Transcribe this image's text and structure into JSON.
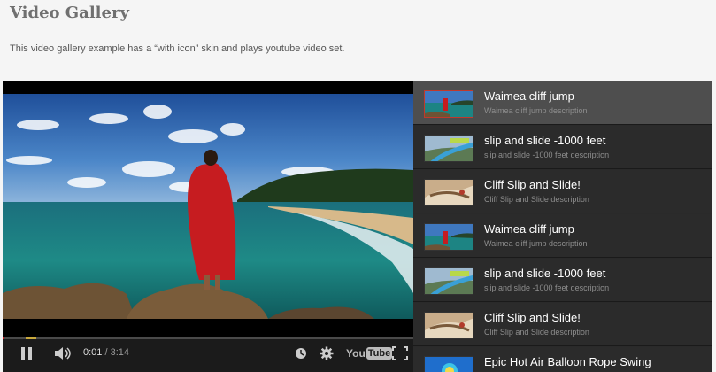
{
  "page": {
    "title": "Video Gallery",
    "description": "This video gallery example has a “with icon” skin and plays youtube video set."
  },
  "player": {
    "current_time": "0:01",
    "separator": " / ",
    "duration": "3:14",
    "progress_fraction": 0.005,
    "logo_you": "You",
    "logo_tube": "Tube"
  },
  "playlist": {
    "items": [
      {
        "title": "Waimea cliff jump",
        "description": "Waimea cliff jump description",
        "thumb": "coast",
        "active": true
      },
      {
        "title": "slip and slide -1000 feet",
        "description": "slip and slide -1000 feet description",
        "thumb": "slide",
        "active": false
      },
      {
        "title": "Cliff Slip and Slide!",
        "description": "Cliff Slip and Slide description",
        "thumb": "cliff",
        "active": false
      },
      {
        "title": "Waimea cliff jump",
        "description": "Waimea cliff jump description",
        "thumb": "coast",
        "active": false
      },
      {
        "title": "slip and slide -1000 feet",
        "description": "slip and slide -1000 feet description",
        "thumb": "slide",
        "active": false
      },
      {
        "title": "Cliff Slip and Slide!",
        "description": "Cliff Slip and Slide description",
        "thumb": "cliff",
        "active": false
      },
      {
        "title": "Epic Hot Air Balloon Rope Swing",
        "description": "",
        "thumb": "balloon",
        "active": false
      }
    ]
  },
  "colors": {
    "progress": "#cc181e",
    "active_item": "#4e4e4e",
    "item_bg": "#2b2b2b"
  }
}
